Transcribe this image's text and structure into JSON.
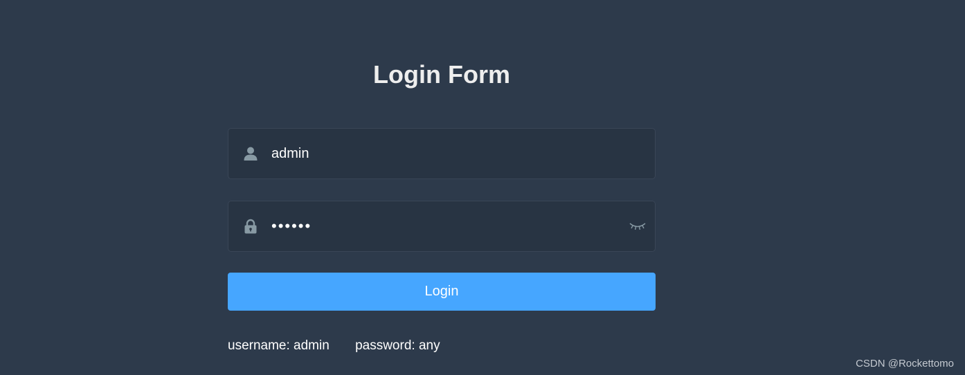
{
  "form": {
    "title": "Login Form",
    "username": {
      "value": "admin",
      "icon": "user-icon"
    },
    "password": {
      "value": "123456",
      "icon": "lock-icon",
      "toggle_icon": "eye-closed-icon"
    },
    "login_label": "Login",
    "tips": {
      "username": "username: admin",
      "password": "password: any"
    }
  },
  "watermark": "CSDN @Rockettomo",
  "colors": {
    "background": "#2d3a4b",
    "input_background": "#283443",
    "button": "#46a6ff",
    "icon": "#889aa4",
    "title": "#eeeeee"
  }
}
